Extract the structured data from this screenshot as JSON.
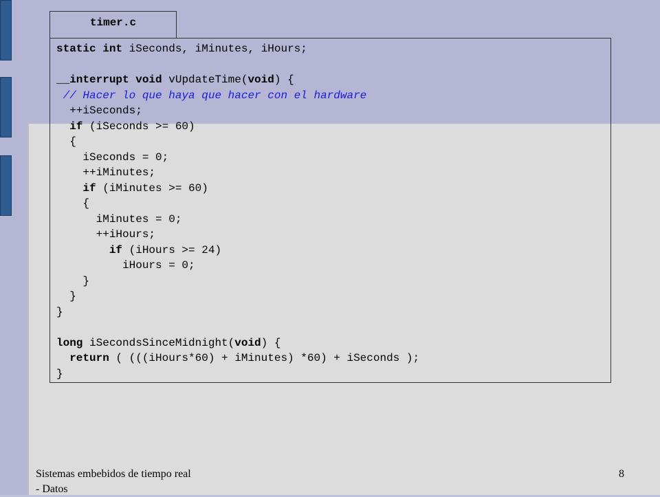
{
  "slide": {
    "tab_label": "timer.c",
    "footer_text": "Sistemas embebidos de tiempo real - Datos",
    "page_number": "8"
  },
  "code": [
    [
      {
        "t": "static int ",
        "s": "kw"
      },
      {
        "t": "iSeconds, iMinutes, iHours;"
      }
    ],
    [
      {
        "t": ""
      }
    ],
    [
      {
        "t": "__interrupt void ",
        "s": "kw"
      },
      {
        "t": "vUpdateTime("
      },
      {
        "t": "void",
        "s": "kw"
      },
      {
        "t": ") {"
      }
    ],
    [
      {
        "t": " // Hacer lo que haya que hacer con el hardware",
        "s": "cm"
      }
    ],
    [
      {
        "t": "  ++iSeconds;"
      }
    ],
    [
      {
        "t": "  "
      },
      {
        "t": "if",
        "s": "kw"
      },
      {
        "t": " (iSeconds >= 60)"
      }
    ],
    [
      {
        "t": "  {"
      }
    ],
    [
      {
        "t": "    iSeconds = 0;"
      }
    ],
    [
      {
        "t": "    ++iMinutes;"
      }
    ],
    [
      {
        "t": "    "
      },
      {
        "t": "if",
        "s": "kw"
      },
      {
        "t": " (iMinutes >= 60)"
      }
    ],
    [
      {
        "t": "    {"
      }
    ],
    [
      {
        "t": "      iMinutes = 0;"
      }
    ],
    [
      {
        "t": "      ++iHours;"
      }
    ],
    [
      {
        "t": "        "
      },
      {
        "t": "if",
        "s": "kw"
      },
      {
        "t": " (iHours >= 24)"
      }
    ],
    [
      {
        "t": "          iHours = 0;"
      }
    ],
    [
      {
        "t": "    }"
      }
    ],
    [
      {
        "t": "  }"
      }
    ],
    [
      {
        "t": "}"
      }
    ],
    [
      {
        "t": ""
      }
    ],
    [
      {
        "t": "long ",
        "s": "kw"
      },
      {
        "t": "iSecondsSinceMidnight("
      },
      {
        "t": "void",
        "s": "kw"
      },
      {
        "t": ") {"
      }
    ],
    [
      {
        "t": "  "
      },
      {
        "t": "return",
        "s": "kw"
      },
      {
        "t": " ( (((iHours*60) + iMinutes) *60) + iSeconds );"
      }
    ],
    [
      {
        "t": "}"
      }
    ]
  ],
  "colors": {
    "accent_bar": "#2f5d92",
    "comment": "#1a1ae6",
    "content_bg": "#dcdcdc"
  }
}
